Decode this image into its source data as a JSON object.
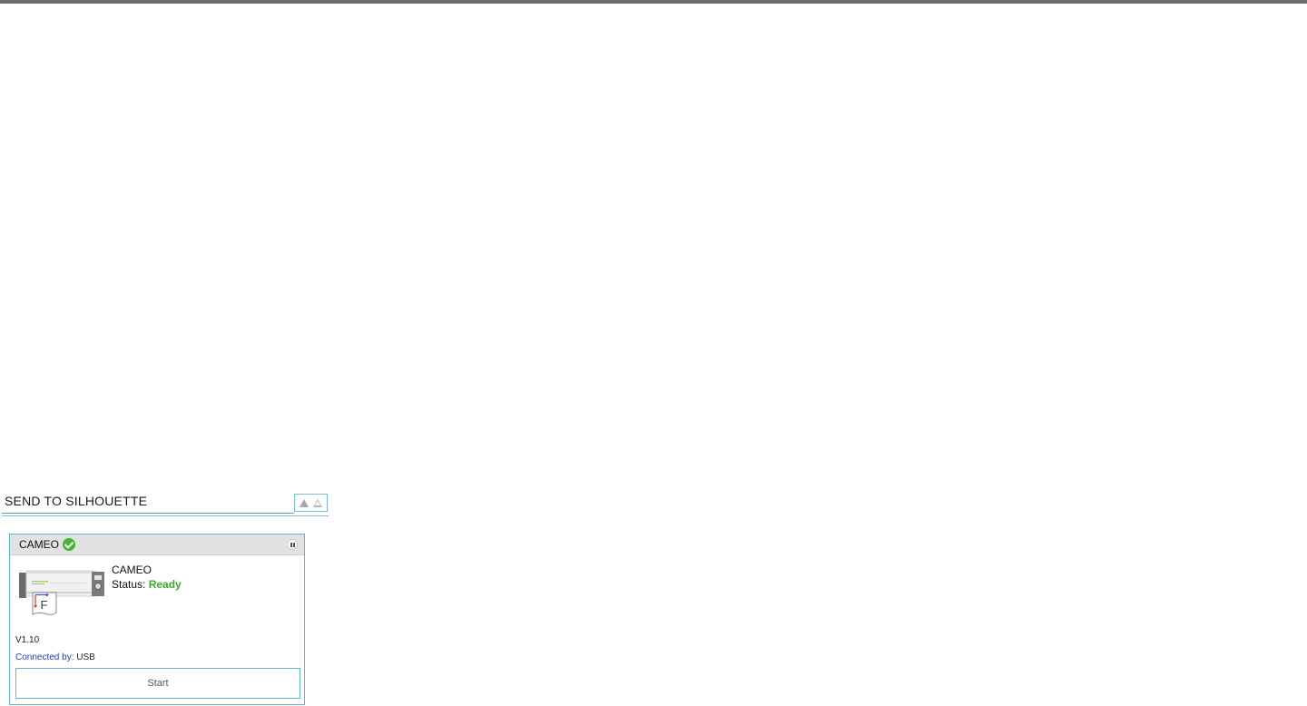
{
  "panel": {
    "title": "SEND TO SILHOUETTE",
    "controls": [
      "collapse-up-filled-icon",
      "collapse-up-outline-icon"
    ]
  },
  "device": {
    "header_name": "CAMEO",
    "connected_icon": "check-circle-icon",
    "pause_icon": "pause-icon",
    "image_icon": "cameo-cutter-image",
    "model": "CAMEO",
    "status_label": "Status:",
    "status_value": "Ready",
    "version": "V1.10",
    "connected_label": "Connected by:",
    "connected_value": "USB",
    "start_label": "Start"
  },
  "colors": {
    "accent": "#62b6cc",
    "status_ready": "#3fab27",
    "connected_label": "#2a37c8",
    "top_bar": "#6e6e6e"
  }
}
